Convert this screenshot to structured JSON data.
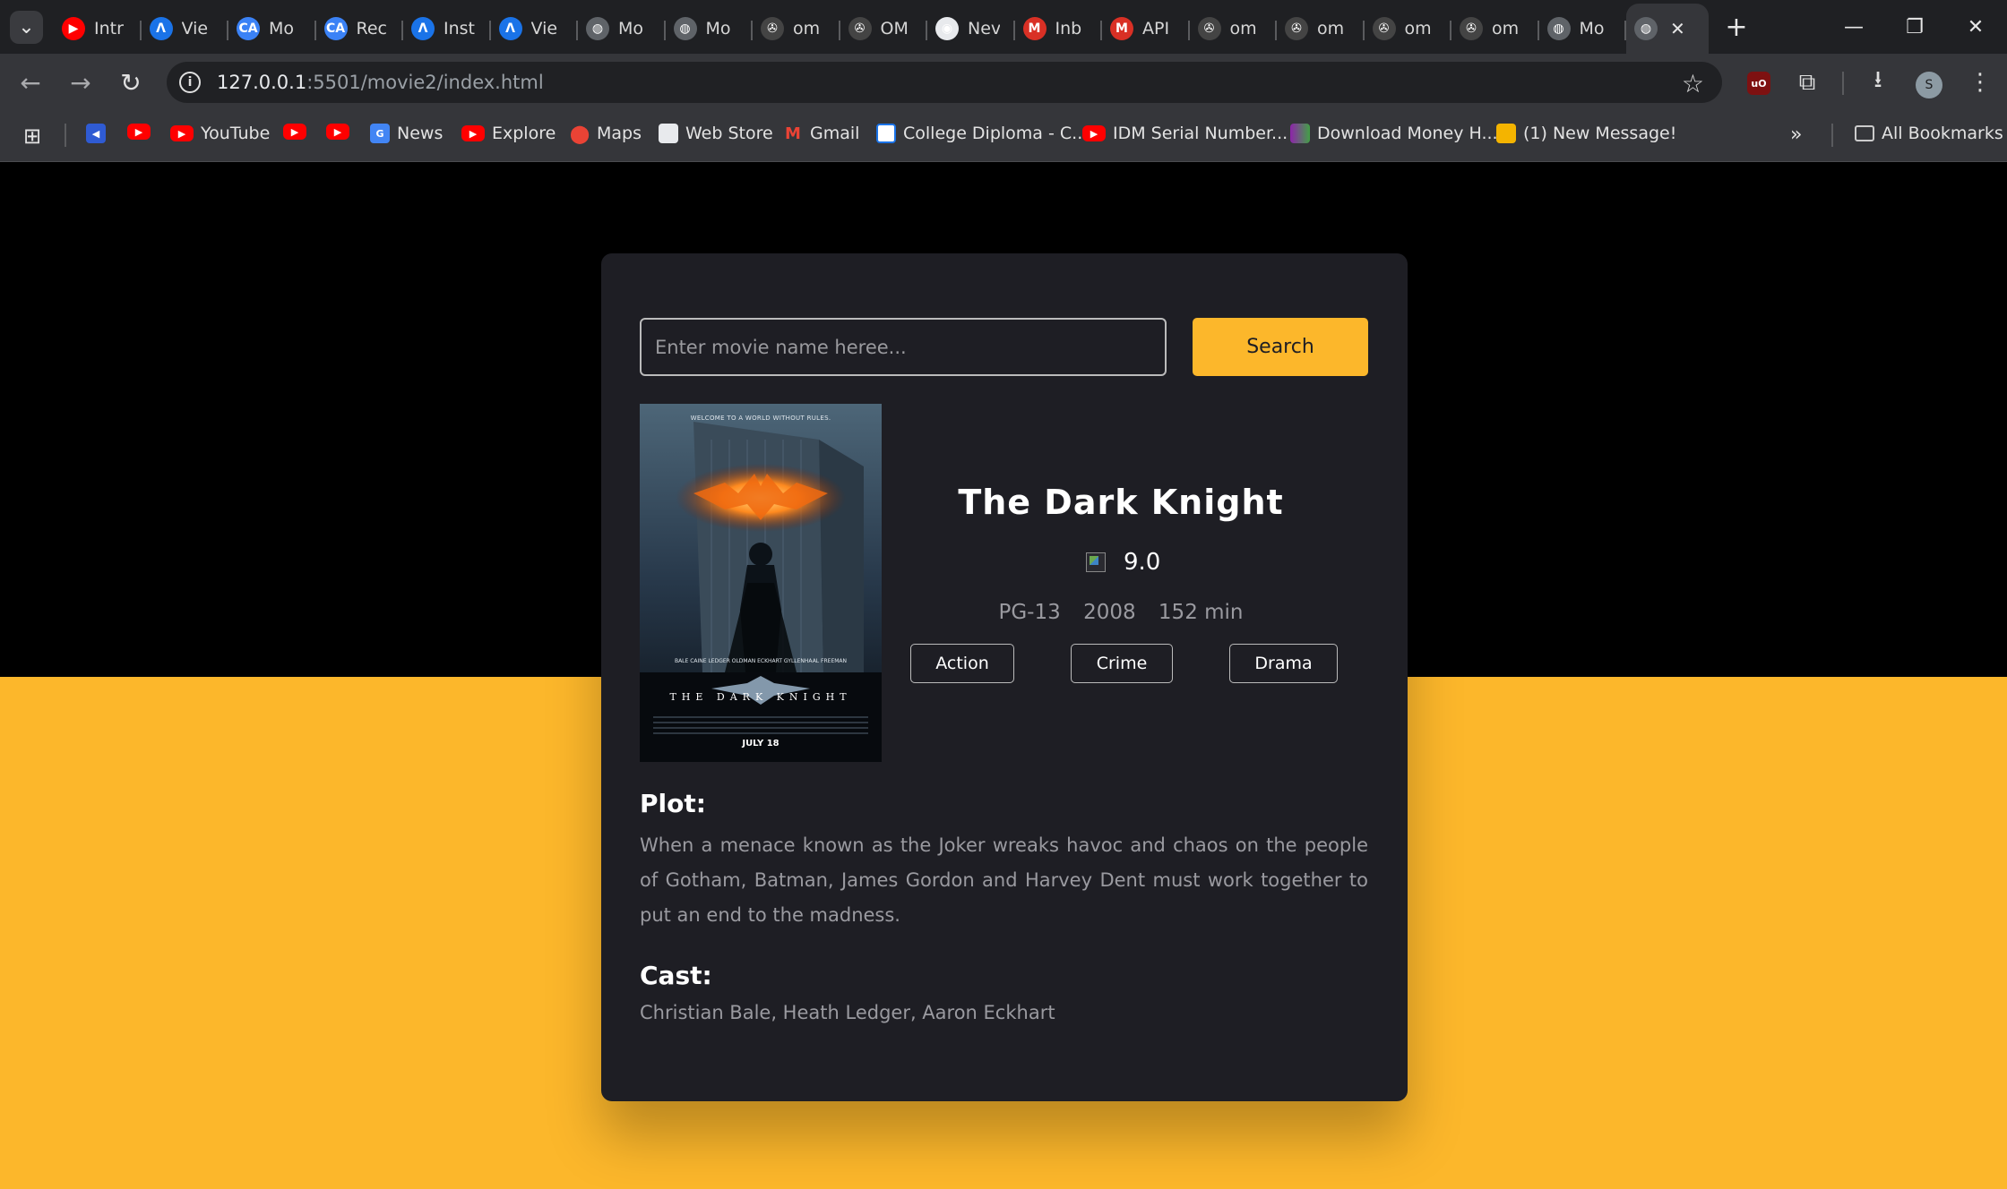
{
  "browser": {
    "tabs": [
      {
        "title": "Intr",
        "icon": "youtube-icon",
        "color": "#ff0000",
        "glyph": "▶"
      },
      {
        "title": "Vie",
        "icon": "a-logo-icon",
        "color": "#1a73e8",
        "glyph": "Λ"
      },
      {
        "title": "Mo",
        "icon": "ca-logo-icon",
        "color": "#3b82f6",
        "glyph": "CA"
      },
      {
        "title": "Rec",
        "icon": "ca-logo-icon",
        "color": "#3b82f6",
        "glyph": "CA"
      },
      {
        "title": "Inst",
        "icon": "a-logo-icon",
        "color": "#1a73e8",
        "glyph": "Λ"
      },
      {
        "title": "Vie",
        "icon": "a-logo-icon",
        "color": "#1a73e8",
        "glyph": "Λ"
      },
      {
        "title": "Mo",
        "icon": "globe-icon",
        "color": "#5f6368",
        "glyph": "◍"
      },
      {
        "title": "Mo",
        "icon": "globe-icon",
        "color": "#5f6368",
        "glyph": "◍"
      },
      {
        "title": "om",
        "icon": "film-reel-icon",
        "color": "#444",
        "glyph": "✇"
      },
      {
        "title": "OM",
        "icon": "film-reel-icon",
        "color": "#444",
        "glyph": "✇"
      },
      {
        "title": "Nev",
        "icon": "chrome-icon",
        "color": "#e8eaed",
        "glyph": "◉"
      },
      {
        "title": "Inb",
        "icon": "gmail-icon",
        "color": "#d93025",
        "glyph": "M"
      },
      {
        "title": "API",
        "icon": "gmail-icon",
        "color": "#d93025",
        "glyph": "M"
      },
      {
        "title": "om",
        "icon": "film-reel-icon",
        "color": "#444",
        "glyph": "✇"
      },
      {
        "title": "om",
        "icon": "film-reel-icon",
        "color": "#444",
        "glyph": "✇"
      },
      {
        "title": "om",
        "icon": "film-reel-icon",
        "color": "#444",
        "glyph": "✇"
      },
      {
        "title": "om",
        "icon": "film-reel-icon",
        "color": "#444",
        "glyph": "✇"
      },
      {
        "title": "Mo",
        "icon": "globe-icon",
        "color": "#5f6368",
        "glyph": "◍"
      }
    ],
    "url_host": "127.0.0.1",
    "url_path": ":5501/movie2/index.html",
    "bookmarks": [
      {
        "label": "YouTube",
        "icon": "youtube-icon"
      },
      {
        "label": "News",
        "icon": "google-news-icon"
      },
      {
        "label": "Explore",
        "icon": "youtube-icon"
      },
      {
        "label": "Maps",
        "icon": "maps-pin-icon"
      },
      {
        "label": "Web Store",
        "icon": "web-store-icon"
      },
      {
        "label": "Gmail",
        "icon": "gmail-icon"
      },
      {
        "label": "College Diploma - C...",
        "icon": "diploma-icon"
      },
      {
        "label": "IDM Serial Number...",
        "icon": "youtube-icon"
      },
      {
        "label": "Download Money H...",
        "icon": "money-icon"
      },
      {
        "label": "(1) New Message!",
        "icon": "message-icon"
      }
    ],
    "all_bookmarks": "All Bookmarks",
    "avatar_letter": "S"
  },
  "app": {
    "search": {
      "placeholder": "Enter movie name heree...",
      "value": "",
      "button_label": "Search"
    },
    "movie": {
      "title": "The Dark Knight",
      "rating": "9.0",
      "rated": "PG-13",
      "year": "2008",
      "runtime": "152 min",
      "genres": [
        "Action",
        "Crime",
        "Drama"
      ],
      "plot_heading": "Plot:",
      "plot": "When a menace known as the Joker wreaks havoc and chaos on the people of Gotham, Batman, James Gordon and Harvey Dent must work together to put an end to the madness.",
      "cast_heading": "Cast:",
      "cast": "Christian Bale, Heath Ledger, Aaron Eckhart"
    },
    "poster": {
      "tagline": "WELCOME TO A WORLD WITHOUT RULES.",
      "credits": "BALE  CAINE  LEDGER  OLDMAN  ECKHART  GYLLENHAAL  FREEMAN",
      "title": "THE DARK KNIGHT",
      "date": "JULY 18"
    },
    "colors": {
      "accent": "#fcb72b",
      "card": "#1e1e24",
      "page": "#000000"
    }
  }
}
